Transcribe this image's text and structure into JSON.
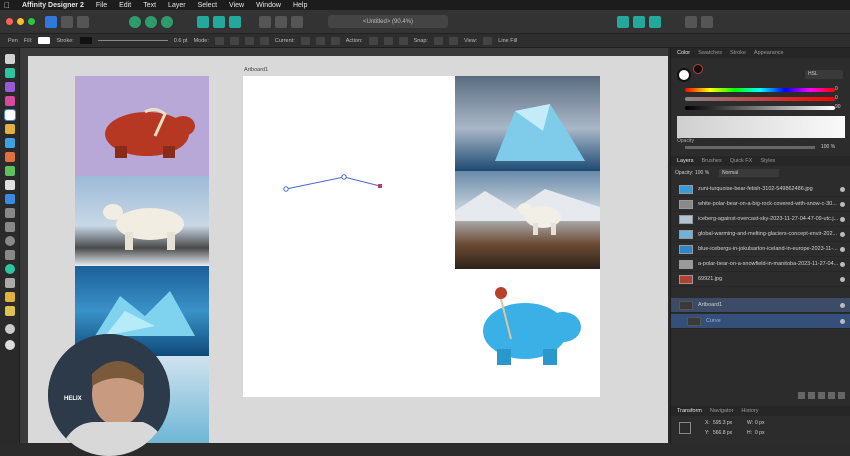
{
  "menubar": {
    "app_name": "Affinity Designer 2",
    "items": [
      "File",
      "Edit",
      "Text",
      "Layer",
      "Select",
      "View",
      "Window",
      "Help"
    ]
  },
  "toolbar": {
    "document_title": "<Untitled> (90.4%)"
  },
  "context": {
    "pen_label": "Pen",
    "fill_label": "Fill:",
    "stroke_label": "Stroke:",
    "stroke_width": "0.6 pt",
    "mode_label": "Mode:",
    "current_label": "Current:",
    "action_label": "Action:",
    "snap_label": "Snap:",
    "view_label": "View:",
    "line_fill_label": "Line Fill"
  },
  "canvas": {
    "artboard_label": "Artboard1"
  },
  "panel": {
    "top_tabs": [
      "Color",
      "Swatches",
      "Stroke",
      "Appearance"
    ],
    "color_model": "HSL",
    "values": [
      "0",
      "0",
      "90"
    ],
    "opacity_label": "Opacity",
    "opacity_value": "100 %",
    "layer_tabs": [
      "Layers",
      "Brushes",
      "Quick FX",
      "Styles"
    ],
    "layer_opacity_label": "Opacity:",
    "layer_opacity": "100 %",
    "blend_mode": "Normal",
    "layers": [
      {
        "name": "zuni-turquoise-bear-fetish-3102-549862486.jpg",
        "color": "#3b9bd6"
      },
      {
        "name": "white-polar-bear-on-a-big-rock-covered-with-snow-c-30...",
        "color": "#8a8a8a"
      },
      {
        "name": "iceberg-against-overcast-sky-2023-11-27-04-47-09-utc.j...",
        "color": "#b0c4d6"
      },
      {
        "name": "global-warming-and-melting-glaciers-concept-envir-202...",
        "color": "#6fb1d8"
      },
      {
        "name": "blue-icebergs-in-jokulsarlon-iceland-in-europe-2023-11-...",
        "color": "#2f86c5"
      },
      {
        "name": "a-polar-bear-on-a-snowfield-in-manitoba-2023-11-27-04...",
        "color": "#9b9b9b"
      },
      {
        "name": "69921.jpg",
        "color": "#b04030"
      },
      {
        "name": "Artboard1",
        "color": "#3a3a3a"
      },
      {
        "name": "Curve",
        "color": "#3a3a3a"
      }
    ],
    "bottom_tabs": [
      "Transform",
      "Navigator",
      "History"
    ],
    "transform": {
      "x_label": "X:",
      "x_value": "595.3 px",
      "y_label": "Y:",
      "y_value": "566.8 px",
      "w_label": "W:",
      "w_value": "0 px",
      "h_label": "H:",
      "h_value": "0 px"
    }
  },
  "webcam": {
    "shirt_text": "HELIX"
  }
}
